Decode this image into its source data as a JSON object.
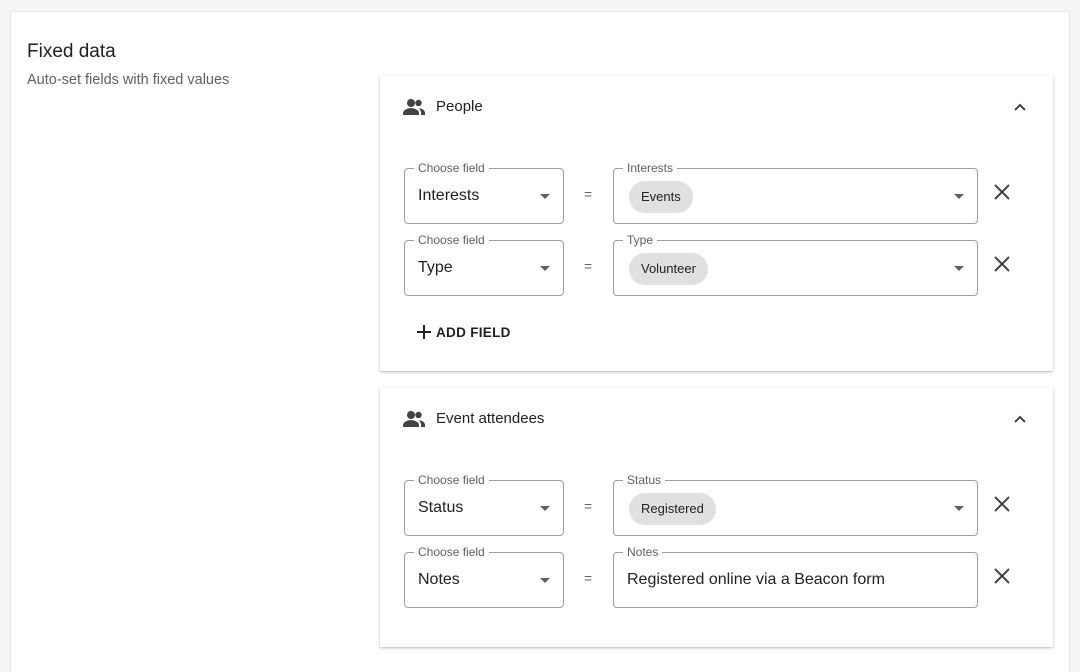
{
  "section": {
    "title": "Fixed data",
    "subtitle": "Auto-set fields with fixed values"
  },
  "panels": [
    {
      "title": "People",
      "rows": [
        {
          "field_label": "Choose field",
          "field_value": "Interests",
          "equals": "=",
          "value_label": "Interests",
          "value": "Events"
        },
        {
          "field_label": "Choose field",
          "field_value": "Type",
          "equals": "=",
          "value_label": "Type",
          "value": "Volunteer"
        }
      ],
      "add_label": "ADD FIELD"
    },
    {
      "title": "Event attendees",
      "rows": [
        {
          "field_label": "Choose field",
          "field_value": "Status",
          "equals": "=",
          "value_label": "Status",
          "value": "Registered"
        },
        {
          "field_label": "Choose field",
          "field_value": "Notes",
          "equals": "=",
          "value_label": "Notes",
          "value": "Registered online via a Beacon form"
        }
      ]
    }
  ],
  "icons": {
    "panel": "people-icon",
    "collapse": "chevron-up-icon",
    "remove": "close-icon",
    "dropdown": "caret-down-icon",
    "add": "plus-icon"
  }
}
